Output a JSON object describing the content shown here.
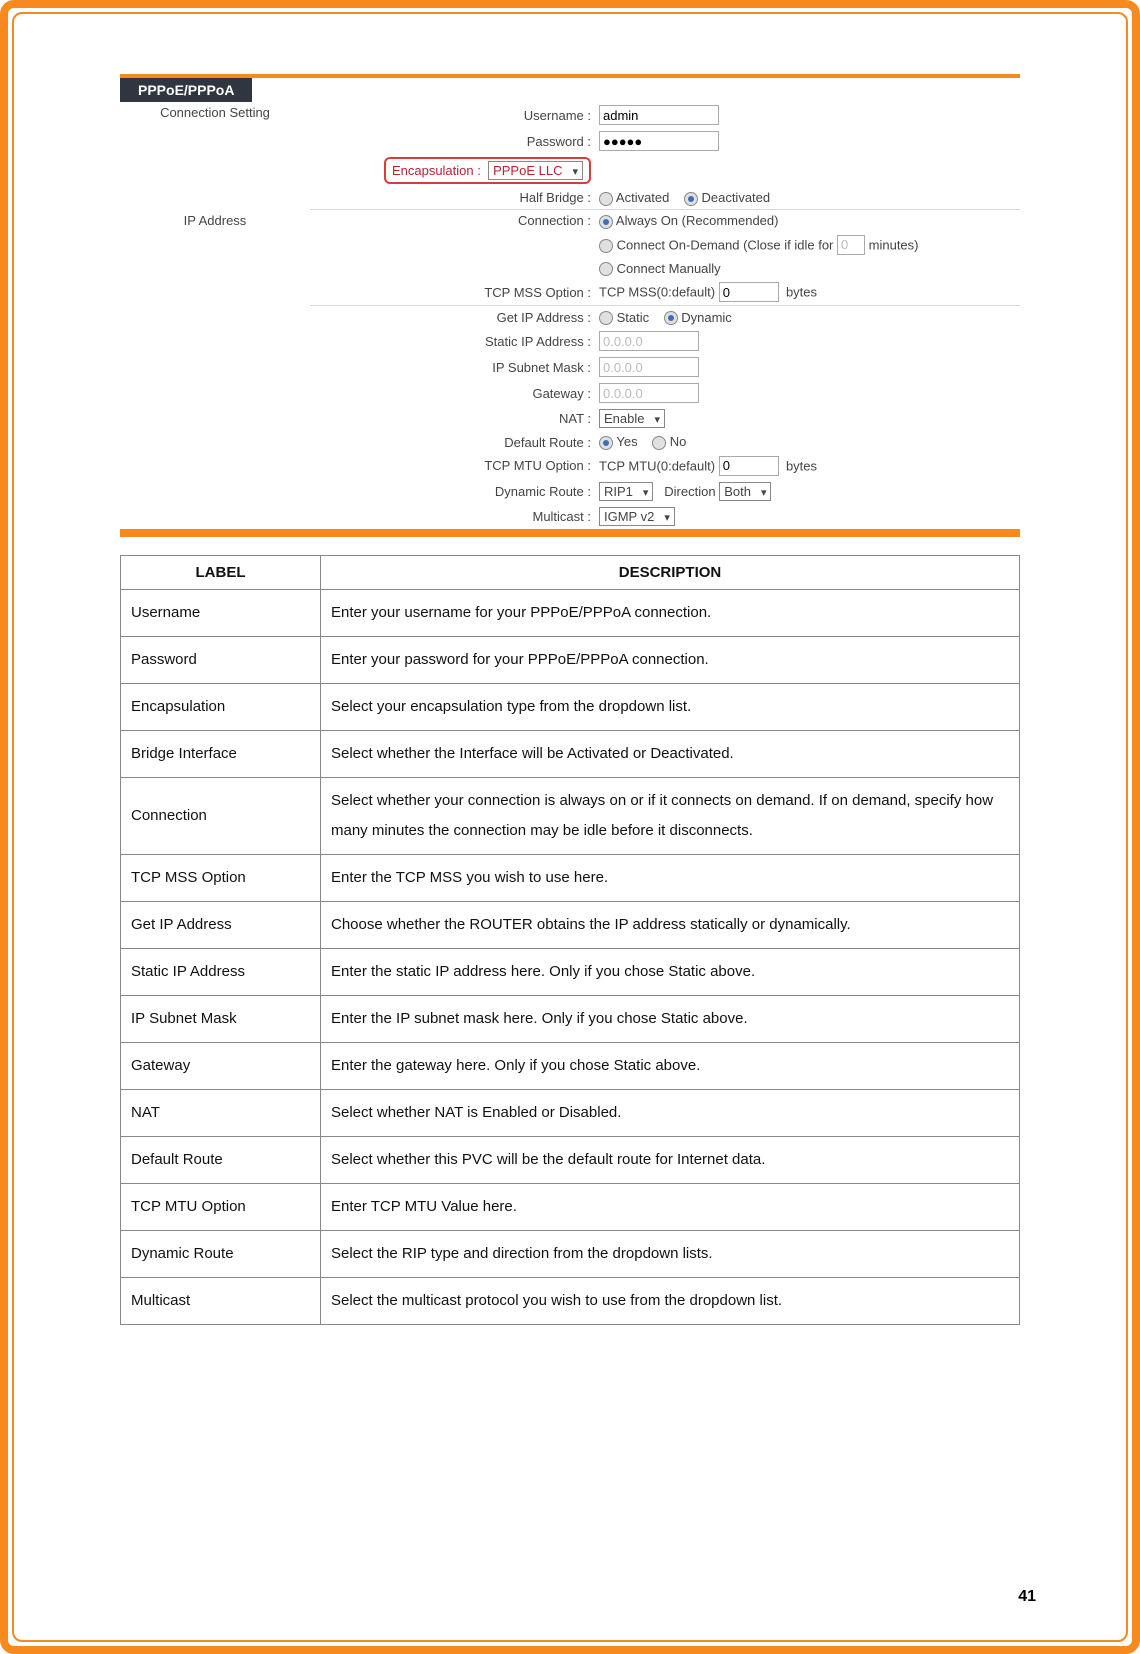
{
  "tab_title": "PPPoE/PPPoA",
  "sections": {
    "conn": "Connection Setting",
    "ip": "IP Address"
  },
  "labels": {
    "username": "Username :",
    "password": "Password :",
    "encapsulation": "Encapsulation :",
    "half_bridge": "Half Bridge :",
    "connection": "Connection :",
    "tcp_mss": "TCP MSS Option :",
    "get_ip": "Get IP Address :",
    "static_ip": "Static IP Address :",
    "subnet": "IP Subnet Mask :",
    "gateway": "Gateway :",
    "nat": "NAT :",
    "default_route": "Default Route :",
    "tcp_mtu": "TCP MTU Option :",
    "dyn_route": "Dynamic Route :",
    "direction": "Direction",
    "multicast": "Multicast :"
  },
  "values": {
    "username": "admin",
    "password": "●●●●●",
    "encapsulation": "PPPoE LLC",
    "half_bridge_activated": "Activated",
    "half_bridge_deactivated": "Deactivated",
    "conn_always": "Always On (Recommended)",
    "conn_demand": "Connect On-Demand (Close if idle for",
    "conn_demand_val": "0",
    "conn_demand_tail": "minutes)",
    "conn_manual": "Connect Manually",
    "tcp_mss": "TCP MSS(0:default)",
    "tcp_mss_val": "0",
    "bytes": "bytes",
    "get_ip_static": "Static",
    "get_ip_dynamic": "Dynamic",
    "static_ip": "0.0.0.0",
    "subnet": "0.0.0.0",
    "gateway": "0.0.0.0",
    "nat": "Enable",
    "def_yes": "Yes",
    "def_no": "No",
    "tcp_mtu": "TCP MTU(0:default)",
    "tcp_mtu_val": "0",
    "dyn_route": "RIP1",
    "direction": "Both",
    "multicast": "IGMP v2"
  },
  "table_headers": {
    "label": "LABEL",
    "description": "DESCRIPTION"
  },
  "table": [
    {
      "label": "Username",
      "desc": "Enter your username for your PPPoE/PPPoA connection."
    },
    {
      "label": "Password",
      "desc": "Enter your password for your PPPoE/PPPoA connection."
    },
    {
      "label": "Encapsulation",
      "desc": "Select your encapsulation type from the dropdown list."
    },
    {
      "label": "Bridge Interface",
      "desc": "Select whether the Interface will be Activated or Deactivated."
    },
    {
      "label": "Connection",
      "desc": "Select whether your connection is always on or if it connects on demand. If on demand, specify how many minutes the connection may be idle before it disconnects."
    },
    {
      "label": "TCP MSS Option",
      "desc": "Enter the TCP MSS you wish to use here."
    },
    {
      "label": "Get IP Address",
      "desc": "Choose whether the ROUTER obtains the IP address statically or dynamically."
    },
    {
      "label": "Static IP Address",
      "desc": "Enter the static IP address here. Only if you chose Static above."
    },
    {
      "label": "IP Subnet Mask",
      "desc": "Enter the IP subnet mask here. Only if you chose Static above."
    },
    {
      "label": "Gateway",
      "desc": "Enter the gateway here. Only if you chose Static above."
    },
    {
      "label": "NAT",
      "desc": "Select whether NAT is Enabled or Disabled."
    },
    {
      "label": "Default Route",
      "desc": "Select whether this PVC will be the default route for Internet data."
    },
    {
      "label": "TCP MTU Option",
      "desc": "Enter TCP MTU Value here."
    },
    {
      "label": "Dynamic Route",
      "desc": "Select the RIP type and direction from the dropdown lists."
    },
    {
      "label": "Multicast",
      "desc": "Select the multicast protocol you wish to use from the dropdown list."
    }
  ],
  "page_number": "41"
}
